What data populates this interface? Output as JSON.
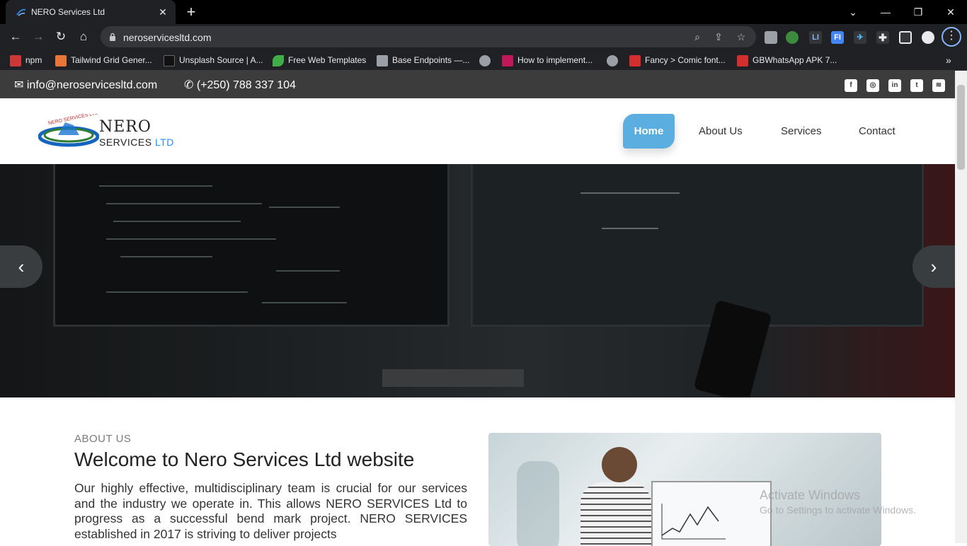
{
  "browser": {
    "tab_title": "NERO Services Ltd",
    "url": "neroservicesltd.com",
    "bookmarks": [
      {
        "label": "npm",
        "icon": "npm-icon",
        "color": "#cb3837"
      },
      {
        "label": "Tailwind Grid Gener...",
        "icon": "tailwind-icon",
        "color": "#e8763a"
      },
      {
        "label": "Unsplash Source | A...",
        "icon": "unsplash-icon",
        "color": "#111111"
      },
      {
        "label": "Free Web Templates",
        "icon": "leaf-icon",
        "color": "#3fae49"
      },
      {
        "label": "Base Endpoints —...",
        "icon": "doc-icon",
        "color": "#9aa0a6"
      },
      {
        "label": "",
        "icon": "globe-icon",
        "color": "#9aa0a6"
      },
      {
        "label": "How to implement...",
        "icon": "s-icon",
        "color": "#c2185b"
      },
      {
        "label": "",
        "icon": "globe-icon",
        "color": "#9aa0a6"
      },
      {
        "label": "Fancy > Comic font...",
        "icon": "f-icon",
        "color": "#d32f2f"
      },
      {
        "label": "GBWhatsApp APK 7...",
        "icon": "gb-icon",
        "color": "#d32f2f"
      }
    ]
  },
  "topbar": {
    "email": "info@neroservicesltd.com",
    "phone": "(+250) 788 337 104"
  },
  "logo": {
    "name": "NERO",
    "services": "SERVICES",
    "ltd": "LTD",
    "ring_text": "NERO SERVICES LTD"
  },
  "nav": {
    "home": "Home",
    "about": "About Us",
    "services": "Services",
    "contact": "Contact"
  },
  "about": {
    "label": "ABOUT US",
    "title": "Welcome to Nero Services Ltd website",
    "text": "Our highly effective, multidisciplinary team is crucial for our services and the industry we operate in. This allows NERO SERVICES Ltd to progress as a successful bend mark project. NERO SERVICES established in 2017 is striving to deliver projects"
  },
  "watermark": {
    "line1": "Activate Windows",
    "line2": "Go to Settings to activate Windows."
  },
  "colors": {
    "accent": "#5aaee0",
    "topbar": "#3c3c3c"
  }
}
